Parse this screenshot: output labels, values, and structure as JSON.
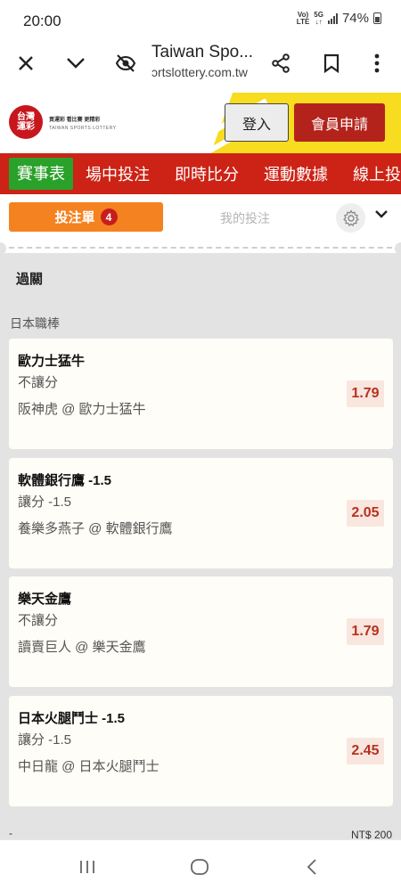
{
  "status_bar": {
    "time": "20:00",
    "network_top": "Vo)",
    "network_bottom": "LTE",
    "fiveg_top": "5G",
    "fiveg_bottom": "↓↑",
    "battery": "74%"
  },
  "browser": {
    "title": "Taiwan Spo...",
    "url": "ɔrtslottery.com.tw"
  },
  "site": {
    "logo_line1": "台灣",
    "logo_line2": "運彩",
    "logo_tagline": "買運彩  看比賽  更精彩",
    "logo_english": "TAIWAN SPORTS LOTTERY",
    "login": "登入",
    "register": "會員申請"
  },
  "nav": {
    "items": [
      "賽事表",
      "場中投注",
      "即時比分",
      "運動數據",
      "線上投"
    ]
  },
  "betslip": {
    "tab_active": "投注單",
    "badge_count": "4",
    "tab_inactive": "我的投注",
    "section": "過關",
    "league": "日本職棒",
    "bets": [
      {
        "team": "歐力士猛牛",
        "type": "不讓分",
        "match": "阪神虎 @ 歐力士猛牛",
        "odds": "1.79"
      },
      {
        "team": "軟體銀行鷹 -1.5",
        "type": "讓分 -1.5",
        "match": "養樂多燕子 @ 軟體銀行鷹",
        "odds": "2.05"
      },
      {
        "team": "樂天金鷹",
        "type": "不讓分",
        "match": "讀賣巨人 @ 樂天金鷹",
        "odds": "1.79"
      },
      {
        "team": "日本火腿鬥士 -1.5",
        "type": "讓分 -1.5",
        "match": "中日龍 @ 日本火腿鬥士",
        "odds": "2.45"
      }
    ],
    "bottom_minus": "-",
    "bottom_amount": "NT$ 200"
  },
  "colors": {
    "brand_red": "#cc2316",
    "active_green": "#2aa12a",
    "slip_orange": "#f58220",
    "odds_red": "#b8321f",
    "band_yellow": "#f7dc1f"
  },
  "icons": {
    "close": "close-icon",
    "dropdown": "chevron-down-icon",
    "hide": "eye-off-icon",
    "share": "share-icon",
    "bookmark": "bookmark-icon",
    "menu": "more-vert-icon",
    "settings": "gear-icon",
    "expand": "chevron-down-icon"
  }
}
